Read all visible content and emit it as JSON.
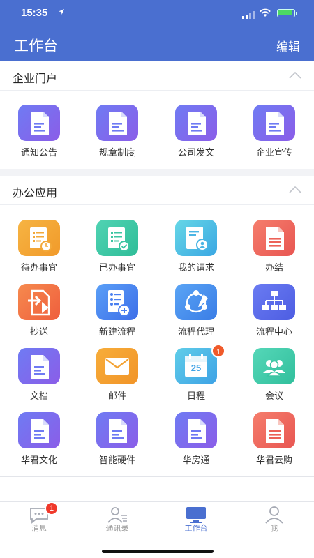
{
  "status": {
    "time": "15:35"
  },
  "nav": {
    "title": "工作台",
    "edit": "编辑"
  },
  "portal": {
    "title": "企业门户",
    "items": [
      {
        "label": "通知公告",
        "icon": "document-icon"
      },
      {
        "label": "规章制度",
        "icon": "document-icon"
      },
      {
        "label": "公司发文",
        "icon": "document-icon"
      },
      {
        "label": "企业宣传",
        "icon": "document-icon"
      }
    ]
  },
  "office": {
    "title": "办公应用",
    "items": [
      {
        "label": "待办事宜",
        "icon": "pending-list-icon"
      },
      {
        "label": "已办事宜",
        "icon": "done-list-icon"
      },
      {
        "label": "我的请求",
        "icon": "my-request-icon"
      },
      {
        "label": "办结",
        "icon": "document-icon"
      },
      {
        "label": "抄送",
        "icon": "forward-icon"
      },
      {
        "label": "新建流程",
        "icon": "new-process-icon"
      },
      {
        "label": "流程代理",
        "icon": "process-proxy-icon"
      },
      {
        "label": "流程中心",
        "icon": "org-chart-icon"
      },
      {
        "label": "文档",
        "icon": "document-icon"
      },
      {
        "label": "邮件",
        "icon": "mail-icon"
      },
      {
        "label": "日程",
        "icon": "calendar-icon",
        "badge": "1",
        "calendar_day": "25"
      },
      {
        "label": "会议",
        "icon": "meeting-icon"
      },
      {
        "label": "华君文化",
        "icon": "document-icon"
      },
      {
        "label": "智能硬件",
        "icon": "document-icon"
      },
      {
        "label": "华房通",
        "icon": "document-icon"
      },
      {
        "label": "华君云购",
        "icon": "document-icon"
      }
    ]
  },
  "tabbar": {
    "items": [
      {
        "label": "消息",
        "icon": "chat-bubble-icon",
        "badge": "1"
      },
      {
        "label": "通讯录",
        "icon": "contacts-icon"
      },
      {
        "label": "工作台",
        "icon": "workbench-icon",
        "active": true
      },
      {
        "label": "我",
        "icon": "profile-icon"
      }
    ]
  },
  "colors": {
    "brand": "#4a6fd0",
    "badge": "#f05a2a"
  }
}
